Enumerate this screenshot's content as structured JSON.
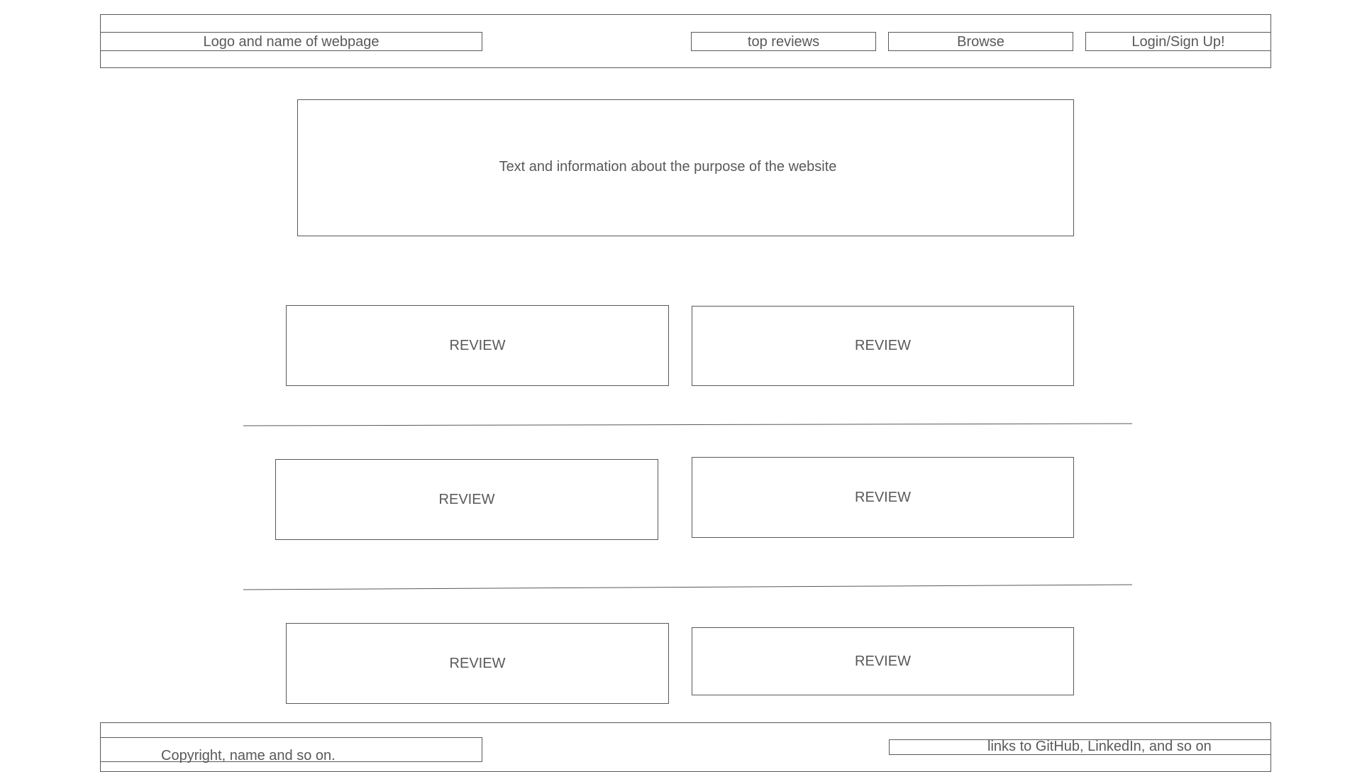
{
  "header": {
    "logo_text": "Logo and name of webpage",
    "nav": {
      "top_reviews": "top reviews",
      "browse": "Browse",
      "login": "Login/Sign Up!"
    }
  },
  "hero": {
    "text": "Text and information about the purpose of the website"
  },
  "reviews": [
    "REVIEW",
    "REVIEW",
    "REVIEW",
    "REVIEW",
    "REVIEW",
    "REVIEW"
  ],
  "footer": {
    "copyright": "Copyright, name and so on.",
    "links": "links to GitHub, LinkedIn, and so on"
  },
  "colors": {
    "stroke": "#595959",
    "background": "#ffffff"
  }
}
